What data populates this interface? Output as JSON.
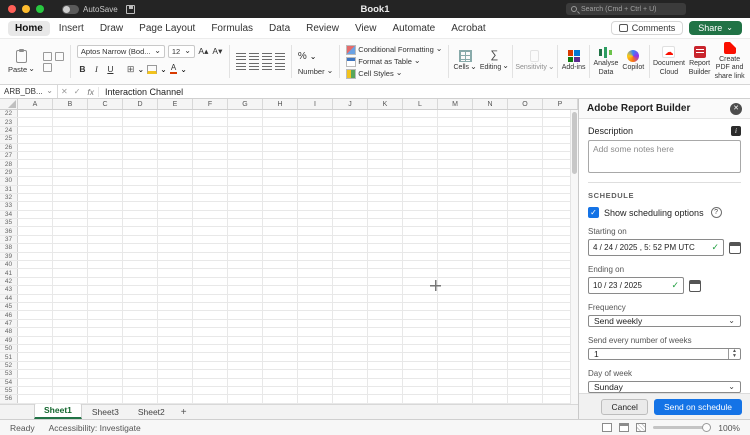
{
  "titlebar": {
    "autosave": "AutoSave",
    "title": "Book1",
    "search_placeholder": "Search (Cmd + Ctrl + U)"
  },
  "tabs": {
    "items": [
      "Home",
      "Insert",
      "Draw",
      "Page Layout",
      "Formulas",
      "Data",
      "Review",
      "View",
      "Automate",
      "Acrobat"
    ],
    "active": "Home"
  },
  "actions": {
    "comments": "Comments",
    "share": "Share"
  },
  "ribbon": {
    "paste": "Paste",
    "font_name": "Aptos Narrow (Bod...",
    "font_size": "12",
    "bold": "B",
    "italic": "I",
    "underline": "U",
    "percent": "%",
    "number": "Number",
    "conditional_formatting": "Conditional Formatting",
    "format_as_table": "Format as Table",
    "cell_styles": "Cell Styles",
    "cells": "Cells",
    "editing": "Editing",
    "sensitivity": "Sensitivity",
    "addins": "Add-ins",
    "analyse_data": "Analyse Data",
    "copilot": "Copilot",
    "document_cloud": "Document Cloud",
    "report_builder": "Report Builder",
    "create_pdf": "Create PDF and share link"
  },
  "formula_bar": {
    "name_box": "ARB_DB...",
    "fx": "fx",
    "content": "Interaction Channel"
  },
  "grid": {
    "columns": [
      "A",
      "B",
      "C",
      "D",
      "E",
      "F",
      "G",
      "H",
      "I",
      "J",
      "K",
      "L",
      "M",
      "N",
      "O",
      "P"
    ],
    "row_start": 22,
    "row_count": 35
  },
  "sheet_tabs": {
    "items": [
      "Sheet1",
      "Sheet3",
      "Sheet2"
    ],
    "active": "Sheet1",
    "add_label": "+"
  },
  "status_bar": {
    "ready": "Ready",
    "accessibility": "Accessibility: Investigate",
    "zoom": "100%"
  },
  "panel": {
    "title": "Adobe Report Builder",
    "description_label": "Description",
    "description_placeholder": "Add some notes here",
    "schedule_heading": "SCHEDULE",
    "show_scheduling_label": "Show scheduling options",
    "starting_on_label": "Starting on",
    "starting_on_value": "4 / 24 / 2025 ,  5: 52  PM  UTC",
    "ending_on_label": "Ending on",
    "ending_on_value": "10 / 23 / 2025",
    "frequency_label": "Frequency",
    "frequency_value": "Send weekly",
    "weeks_label": "Send every number of weeks",
    "weeks_value": "1",
    "day_label": "Day of week",
    "day_value": "Sunday",
    "cancel": "Cancel",
    "submit": "Send on schedule"
  }
}
